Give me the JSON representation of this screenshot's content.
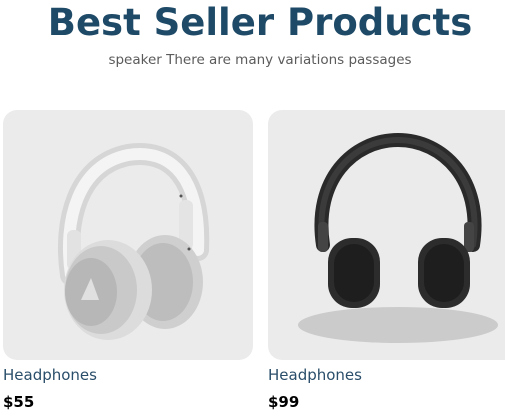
{
  "section": {
    "title": "Best Seller Products",
    "subtitle": "speaker There are many variations passages"
  },
  "products": [
    {
      "name": "Headphones",
      "price": "$55",
      "image_icon": "white-headphones-icon"
    },
    {
      "name": "Headphones",
      "price": "$99",
      "image_icon": "black-headphones-icon"
    }
  ],
  "colors": {
    "title": "#1e4a67",
    "subtitle": "#5b5b5b",
    "card_background": "#ebebeb",
    "product_name": "#2a4e6a",
    "price": "#000000"
  }
}
